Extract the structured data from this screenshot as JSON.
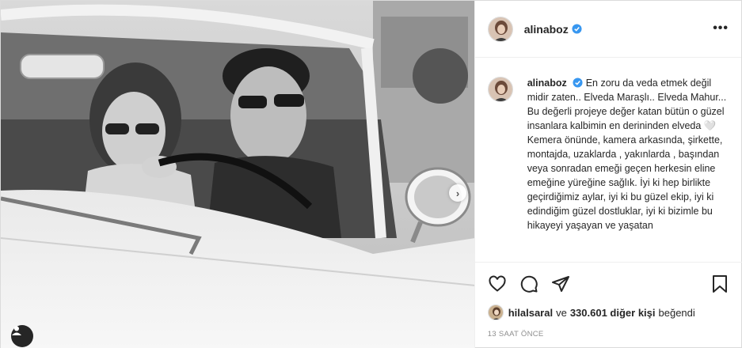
{
  "post": {
    "username": "alinaboz",
    "caption_user": "alinaboz",
    "caption": "En zoru da veda etmek değil midir zaten.. Elveda Maraşlı.. Elveda Mahur... Bu değerli projeye değer katan bütün o güzel insanlara kalbimin en derininden elveda 🤍 Kemera önünde, kamera arkasında, şirkette, montajda, uzaklarda , yakınlarda , başından veya sonradan emeği geçen herkesin eline emeğine yüreğine sağlık. İyi ki hep birlikte geçirdiğimiz aylar, iyi ki bu güzel ekip, iyi ki edindiğim güzel dostluklar, iyi ki bizimle bu hikayeyi yaşayan ve yaşatan",
    "likes": {
      "first_user": "hilalsaral",
      "connector": "ve",
      "others": "330.601 diğer kişi",
      "suffix": "beğendi"
    },
    "timestamp": "13 SAAT ÖNCE"
  },
  "icons": {
    "more": "more-options-icon",
    "like": "heart-icon",
    "comment": "comment-icon",
    "share": "share-icon",
    "save": "bookmark-icon",
    "tag": "user-tag-icon",
    "next": "chevron-right-icon",
    "verified": "verified-badge-icon"
  },
  "colors": {
    "verified": "#3897f0",
    "text": "#262626",
    "muted": "#8e8e8e",
    "border": "#dbdbdb"
  }
}
